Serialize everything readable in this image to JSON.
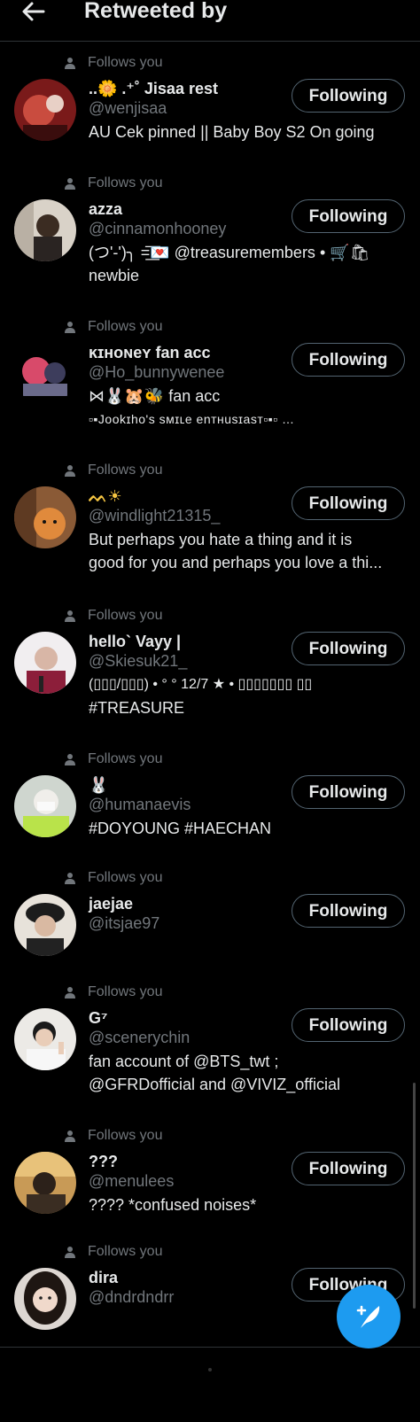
{
  "header": {
    "title": "Retweeted by",
    "back_icon": "arrow-left-icon"
  },
  "follows_you_label": "Follows you",
  "follow_button_label": "Following",
  "users": [
    {
      "name": "..🌼 .⁺˚ Jisaa rest",
      "handle": "@wenjisaa",
      "bio": [
        "AU Cek pinned || Baby Boy S2 On going"
      ]
    },
    {
      "name": "azza",
      "handle": "@cinnamonhooney",
      "bio": [
        "(つ'-')╮ =͟͟͞͞💌 @treasuremembers • 🛒🛍",
        "newbie"
      ]
    },
    {
      "name": "ĸɪнoɴeʏ fan acc",
      "handle": "@Ho_bunnywenee",
      "bio": [
        "⋈🐰🐹🐝 fan acc",
        "▫▪Jookɪho's sмɪʟe enтнusɪasт▫▪▫ …"
      ]
    },
    {
      "name": "ᨓ☀",
      "handle": "@windlight21315_",
      "bio": [
        "But perhaps you hate a thing and it is",
        "good for you and perhaps you love a thi..."
      ]
    },
    {
      "name": "hello` Vayy |",
      "handle": "@Skiesuk21_",
      "bio": [
        "(▯▯▯/▯▯▯) • ° ° 12/7 ★ • ▯▯▯▯▯▯▯ ▯▯",
        "#TREASURE"
      ]
    },
    {
      "name": "🐰",
      "handle": "@humanaevis",
      "bio": [
        "#DOYOUNG #HAECHAN"
      ]
    },
    {
      "name": "jaejae",
      "handle": "@itsjae97",
      "bio": []
    },
    {
      "name": "G⁷",
      "handle": "@scenerychin",
      "bio": [
        "fan account of @BTS_twt ;",
        "@GFRDofficial and @VIVIZ_official"
      ]
    },
    {
      "name": "???",
      "handle": "@menulees",
      "bio": [
        "???? *confused noises*"
      ]
    },
    {
      "name": "dira",
      "handle": "@dndrdndrr",
      "bio": []
    }
  ],
  "fab": {
    "icon": "compose-tweet-icon"
  },
  "colors": {
    "background": "#000000",
    "text": "#e7e9ea",
    "secondary": "#71767b",
    "accent": "#1d9bf0",
    "border": "#536471"
  }
}
